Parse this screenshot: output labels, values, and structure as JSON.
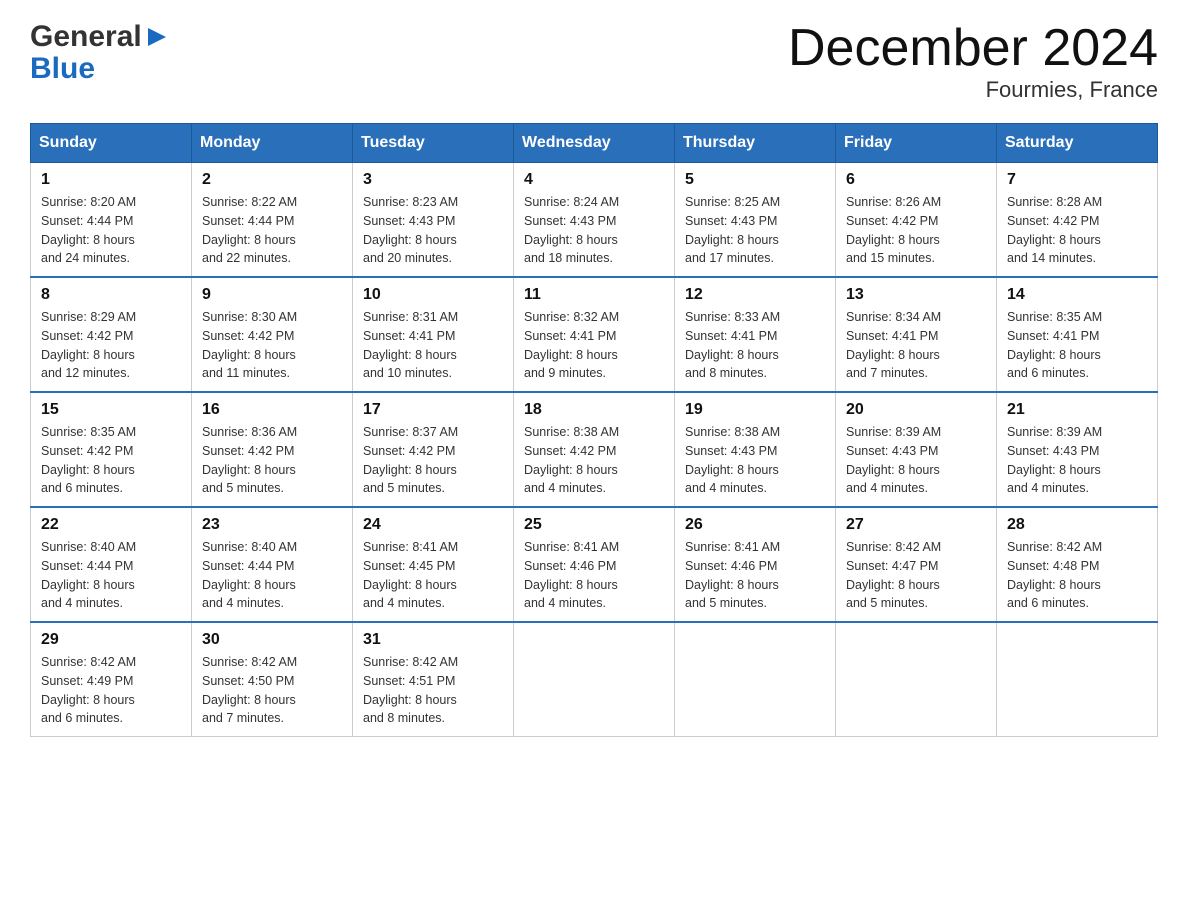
{
  "header": {
    "logo_line1": "General",
    "logo_line2": "Blue",
    "month_title": "December 2024",
    "location": "Fourmies, France"
  },
  "days_of_week": [
    "Sunday",
    "Monday",
    "Tuesday",
    "Wednesday",
    "Thursday",
    "Friday",
    "Saturday"
  ],
  "weeks": [
    [
      {
        "day": "1",
        "sunrise": "Sunrise: 8:20 AM",
        "sunset": "Sunset: 4:44 PM",
        "daylight": "Daylight: 8 hours",
        "daylight2": "and 24 minutes."
      },
      {
        "day": "2",
        "sunrise": "Sunrise: 8:22 AM",
        "sunset": "Sunset: 4:44 PM",
        "daylight": "Daylight: 8 hours",
        "daylight2": "and 22 minutes."
      },
      {
        "day": "3",
        "sunrise": "Sunrise: 8:23 AM",
        "sunset": "Sunset: 4:43 PM",
        "daylight": "Daylight: 8 hours",
        "daylight2": "and 20 minutes."
      },
      {
        "day": "4",
        "sunrise": "Sunrise: 8:24 AM",
        "sunset": "Sunset: 4:43 PM",
        "daylight": "Daylight: 8 hours",
        "daylight2": "and 18 minutes."
      },
      {
        "day": "5",
        "sunrise": "Sunrise: 8:25 AM",
        "sunset": "Sunset: 4:43 PM",
        "daylight": "Daylight: 8 hours",
        "daylight2": "and 17 minutes."
      },
      {
        "day": "6",
        "sunrise": "Sunrise: 8:26 AM",
        "sunset": "Sunset: 4:42 PM",
        "daylight": "Daylight: 8 hours",
        "daylight2": "and 15 minutes."
      },
      {
        "day": "7",
        "sunrise": "Sunrise: 8:28 AM",
        "sunset": "Sunset: 4:42 PM",
        "daylight": "Daylight: 8 hours",
        "daylight2": "and 14 minutes."
      }
    ],
    [
      {
        "day": "8",
        "sunrise": "Sunrise: 8:29 AM",
        "sunset": "Sunset: 4:42 PM",
        "daylight": "Daylight: 8 hours",
        "daylight2": "and 12 minutes."
      },
      {
        "day": "9",
        "sunrise": "Sunrise: 8:30 AM",
        "sunset": "Sunset: 4:42 PM",
        "daylight": "Daylight: 8 hours",
        "daylight2": "and 11 minutes."
      },
      {
        "day": "10",
        "sunrise": "Sunrise: 8:31 AM",
        "sunset": "Sunset: 4:41 PM",
        "daylight": "Daylight: 8 hours",
        "daylight2": "and 10 minutes."
      },
      {
        "day": "11",
        "sunrise": "Sunrise: 8:32 AM",
        "sunset": "Sunset: 4:41 PM",
        "daylight": "Daylight: 8 hours",
        "daylight2": "and 9 minutes."
      },
      {
        "day": "12",
        "sunrise": "Sunrise: 8:33 AM",
        "sunset": "Sunset: 4:41 PM",
        "daylight": "Daylight: 8 hours",
        "daylight2": "and 8 minutes."
      },
      {
        "day": "13",
        "sunrise": "Sunrise: 8:34 AM",
        "sunset": "Sunset: 4:41 PM",
        "daylight": "Daylight: 8 hours",
        "daylight2": "and 7 minutes."
      },
      {
        "day": "14",
        "sunrise": "Sunrise: 8:35 AM",
        "sunset": "Sunset: 4:41 PM",
        "daylight": "Daylight: 8 hours",
        "daylight2": "and 6 minutes."
      }
    ],
    [
      {
        "day": "15",
        "sunrise": "Sunrise: 8:35 AM",
        "sunset": "Sunset: 4:42 PM",
        "daylight": "Daylight: 8 hours",
        "daylight2": "and 6 minutes."
      },
      {
        "day": "16",
        "sunrise": "Sunrise: 8:36 AM",
        "sunset": "Sunset: 4:42 PM",
        "daylight": "Daylight: 8 hours",
        "daylight2": "and 5 minutes."
      },
      {
        "day": "17",
        "sunrise": "Sunrise: 8:37 AM",
        "sunset": "Sunset: 4:42 PM",
        "daylight": "Daylight: 8 hours",
        "daylight2": "and 5 minutes."
      },
      {
        "day": "18",
        "sunrise": "Sunrise: 8:38 AM",
        "sunset": "Sunset: 4:42 PM",
        "daylight": "Daylight: 8 hours",
        "daylight2": "and 4 minutes."
      },
      {
        "day": "19",
        "sunrise": "Sunrise: 8:38 AM",
        "sunset": "Sunset: 4:43 PM",
        "daylight": "Daylight: 8 hours",
        "daylight2": "and 4 minutes."
      },
      {
        "day": "20",
        "sunrise": "Sunrise: 8:39 AM",
        "sunset": "Sunset: 4:43 PM",
        "daylight": "Daylight: 8 hours",
        "daylight2": "and 4 minutes."
      },
      {
        "day": "21",
        "sunrise": "Sunrise: 8:39 AM",
        "sunset": "Sunset: 4:43 PM",
        "daylight": "Daylight: 8 hours",
        "daylight2": "and 4 minutes."
      }
    ],
    [
      {
        "day": "22",
        "sunrise": "Sunrise: 8:40 AM",
        "sunset": "Sunset: 4:44 PM",
        "daylight": "Daylight: 8 hours",
        "daylight2": "and 4 minutes."
      },
      {
        "day": "23",
        "sunrise": "Sunrise: 8:40 AM",
        "sunset": "Sunset: 4:44 PM",
        "daylight": "Daylight: 8 hours",
        "daylight2": "and 4 minutes."
      },
      {
        "day": "24",
        "sunrise": "Sunrise: 8:41 AM",
        "sunset": "Sunset: 4:45 PM",
        "daylight": "Daylight: 8 hours",
        "daylight2": "and 4 minutes."
      },
      {
        "day": "25",
        "sunrise": "Sunrise: 8:41 AM",
        "sunset": "Sunset: 4:46 PM",
        "daylight": "Daylight: 8 hours",
        "daylight2": "and 4 minutes."
      },
      {
        "day": "26",
        "sunrise": "Sunrise: 8:41 AM",
        "sunset": "Sunset: 4:46 PM",
        "daylight": "Daylight: 8 hours",
        "daylight2": "and 5 minutes."
      },
      {
        "day": "27",
        "sunrise": "Sunrise: 8:42 AM",
        "sunset": "Sunset: 4:47 PM",
        "daylight": "Daylight: 8 hours",
        "daylight2": "and 5 minutes."
      },
      {
        "day": "28",
        "sunrise": "Sunrise: 8:42 AM",
        "sunset": "Sunset: 4:48 PM",
        "daylight": "Daylight: 8 hours",
        "daylight2": "and 6 minutes."
      }
    ],
    [
      {
        "day": "29",
        "sunrise": "Sunrise: 8:42 AM",
        "sunset": "Sunset: 4:49 PM",
        "daylight": "Daylight: 8 hours",
        "daylight2": "and 6 minutes."
      },
      {
        "day": "30",
        "sunrise": "Sunrise: 8:42 AM",
        "sunset": "Sunset: 4:50 PM",
        "daylight": "Daylight: 8 hours",
        "daylight2": "and 7 minutes."
      },
      {
        "day": "31",
        "sunrise": "Sunrise: 8:42 AM",
        "sunset": "Sunset: 4:51 PM",
        "daylight": "Daylight: 8 hours",
        "daylight2": "and 8 minutes."
      },
      null,
      null,
      null,
      null
    ]
  ]
}
